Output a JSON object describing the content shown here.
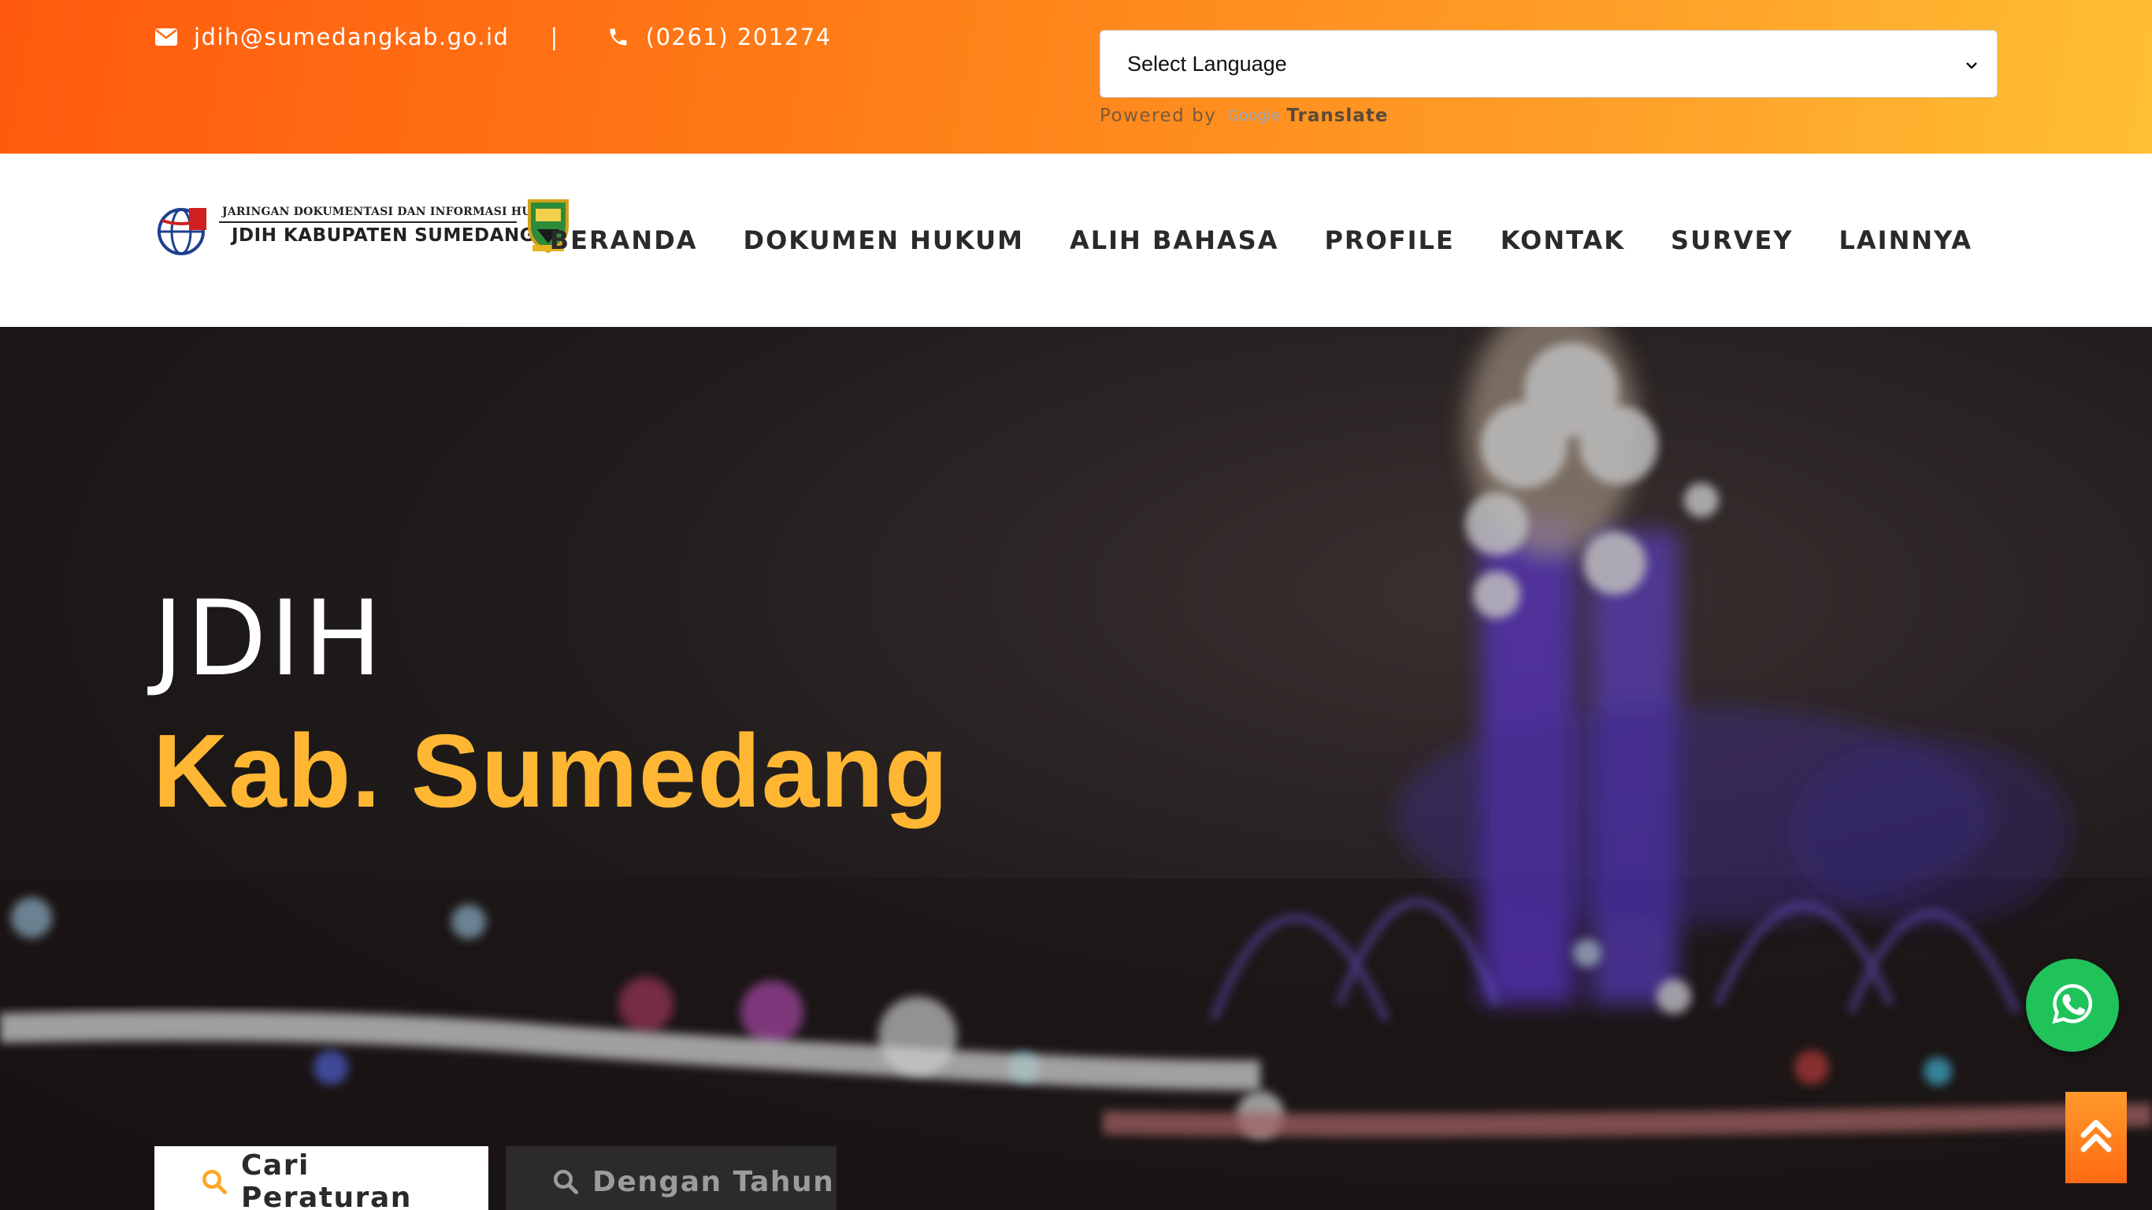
{
  "topbar": {
    "email": "jdih@sumedangkab.go.id",
    "separator": "|",
    "phone": "(0261) 201274",
    "language_select": {
      "selected": "Select Language"
    },
    "powered_by": {
      "prefix": "Powered by",
      "google": "Google",
      "suffix": "Translate"
    }
  },
  "header": {
    "logo": {
      "subtitle": "JARINGAN DOKUMENTASI DAN INFORMASI HUKUM",
      "title": "JDIH KABUPATEN SUMEDANG"
    },
    "nav": [
      {
        "label": "BERANDA"
      },
      {
        "label": "DOKUMEN HUKUM"
      },
      {
        "label": "ALIH BAHASA"
      },
      {
        "label": "PROFILE"
      },
      {
        "label": "KONTAK"
      },
      {
        "label": "SURVEY"
      },
      {
        "label": "LAINNYA"
      }
    ]
  },
  "hero": {
    "title": "JDIH",
    "subtitle": "Kab. Sumedang",
    "tabs": [
      {
        "label": "Cari Peraturan",
        "active": true
      },
      {
        "label": "Dengan Tahun",
        "active": false
      }
    ]
  },
  "colors": {
    "accent": "#ffb733",
    "topbar_start": "#ff5a0e",
    "topbar_end": "#ffc033",
    "whatsapp": "#1fc35a"
  },
  "icons": [
    "envelope-icon",
    "phone-icon",
    "chevron-down-icon",
    "search-icon",
    "whatsapp-icon",
    "double-chevron-up-icon"
  ]
}
